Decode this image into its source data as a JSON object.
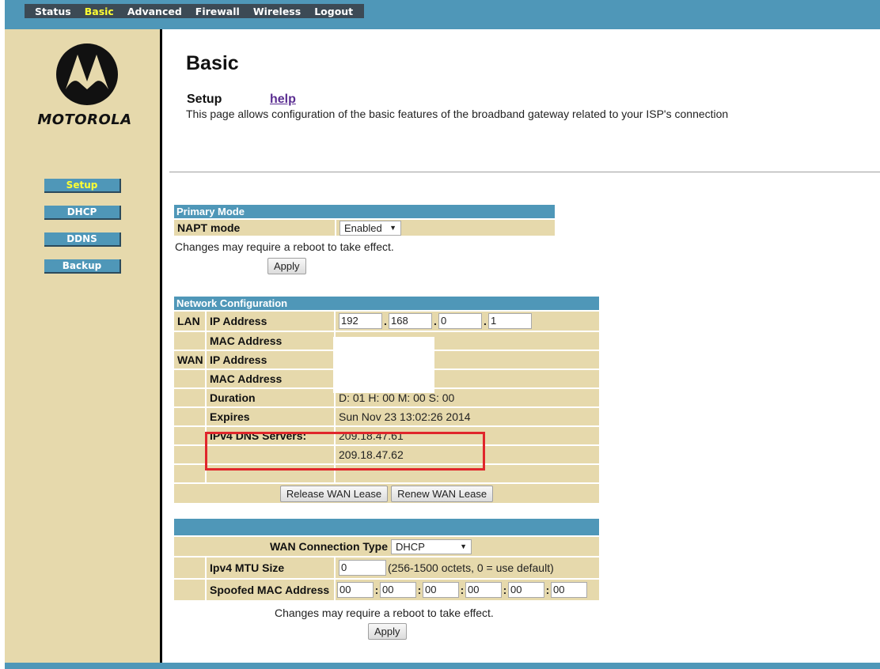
{
  "top_nav": {
    "items": [
      {
        "label": "Status",
        "active": false
      },
      {
        "label": "Basic",
        "active": true
      },
      {
        "label": "Advanced",
        "active": false
      },
      {
        "label": "Firewall",
        "active": false
      },
      {
        "label": "Wireless",
        "active": false
      },
      {
        "label": "Logout",
        "active": false
      }
    ]
  },
  "brand": {
    "logo_text": "MOTOROLA"
  },
  "sub_nav": {
    "items": [
      {
        "label": "Setup",
        "active": true
      },
      {
        "label": "DHCP",
        "active": false
      },
      {
        "label": "DDNS",
        "active": false
      },
      {
        "label": "Backup",
        "active": false
      }
    ]
  },
  "header": {
    "title": "Basic",
    "section": "Setup",
    "help_link": "help",
    "description": "This page allows configuration of the basic features of the broadband gateway related to your ISP's connection"
  },
  "primary_mode": {
    "title": "Primary Mode",
    "napt_label": "NAPT mode",
    "napt_value": "Enabled",
    "note": "Changes may require a reboot to take effect.",
    "apply_label": "Apply"
  },
  "network_config": {
    "title": "Network Configuration",
    "lan_label": "LAN",
    "wan_label": "WAN",
    "lan_ip_label": "IP Address",
    "lan_ip": [
      "192",
      "168",
      "0",
      "1"
    ],
    "lan_mac_label": "MAC Address",
    "wan_ip_label": "IP Address",
    "wan_mac_label": "MAC Address",
    "duration_label": "Duration",
    "duration_value": "D: 01 H: 00 M: 00 S: 00",
    "expires_label": "Expires",
    "expires_value": "Sun Nov 23 13:02:26 2014",
    "dns_label": "IPv4 DNS Servers:",
    "dns_servers": [
      "209.18.47.61",
      "209.18.47.62"
    ],
    "release_label": "Release WAN Lease",
    "renew_label": "Renew WAN Lease"
  },
  "wan_settings": {
    "conn_type_label": "WAN Connection Type",
    "conn_type_value": "DHCP",
    "mtu_label": "Ipv4 MTU Size",
    "mtu_value": "0",
    "mtu_hint": "(256-1500 octets, 0 = use default)",
    "spoofed_mac_label": "Spoofed MAC Address",
    "spoofed_mac": [
      "00",
      "00",
      "00",
      "00",
      "00",
      "00"
    ],
    "note": "Changes may require a reboot to take effect.",
    "apply_label": "Apply"
  },
  "colors": {
    "header_blue": "#4f97b8",
    "sidebar_tan": "#e6d9ac",
    "active_yellow": "#ffff33",
    "highlight_red": "#e0262b",
    "help_purple": "#5a2d91"
  }
}
